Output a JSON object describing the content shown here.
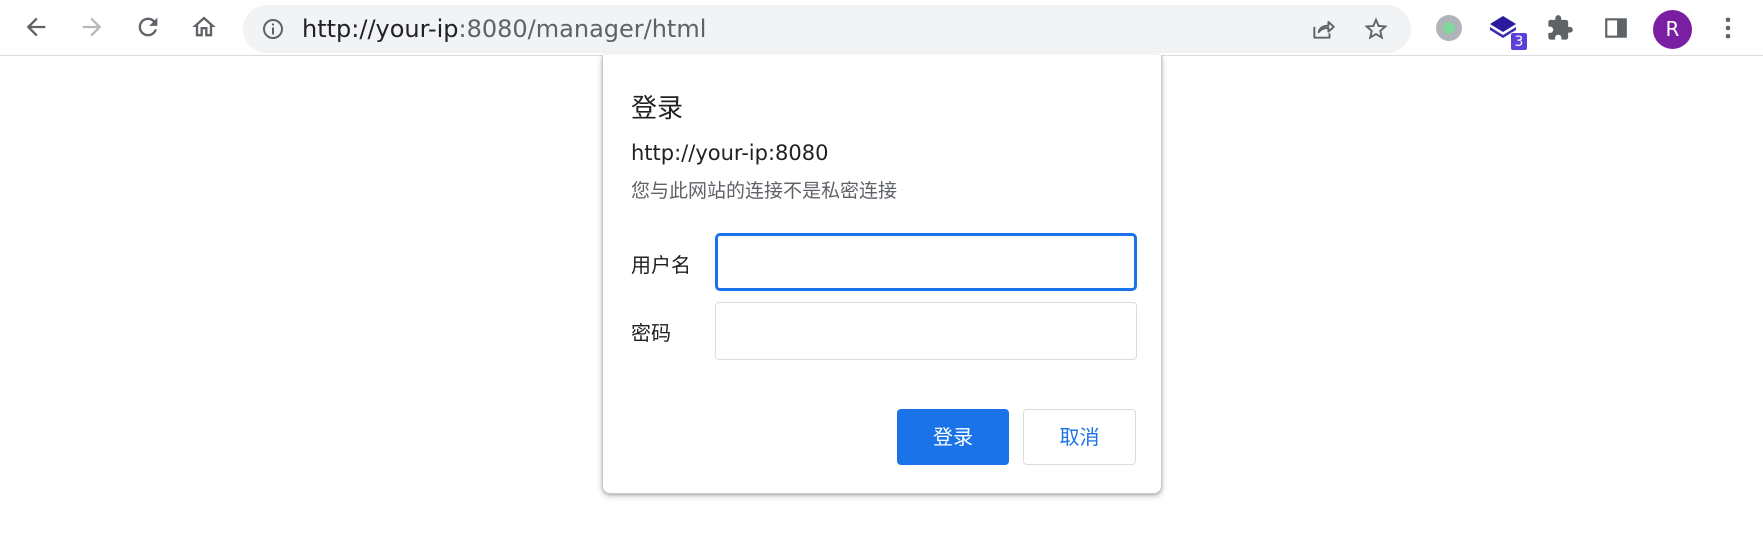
{
  "browser": {
    "url_host": "http://your-ip",
    "url_rest": ":8080/manager/html",
    "extension_badge": "3",
    "avatar_letter": "R",
    "accent_color": "#1a73e8",
    "avatar_color": "#7b1fa2",
    "icons": [
      "back-icon",
      "forward-icon",
      "reload-icon",
      "home-icon",
      "info-icon",
      "share-icon",
      "star-icon",
      "extension-circle-icon",
      "extension-stack-icon",
      "puzzle-icon",
      "side-panel-icon",
      "more-vert-icon"
    ]
  },
  "dialog": {
    "title": "登录",
    "origin": "http://your-ip:8080",
    "warning": "您与此网站的连接不是私密连接",
    "username_label": "用户名",
    "username_value": "",
    "password_label": "密码",
    "password_value": "",
    "login_button": "登录",
    "cancel_button": "取消"
  }
}
